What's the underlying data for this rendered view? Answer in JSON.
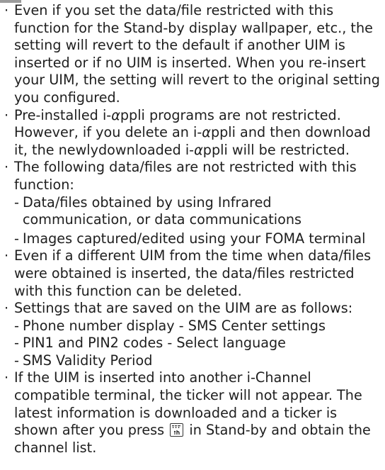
{
  "notes": [
    {
      "text": "Even if you set the data/file restricted with this function for the Stand-by display wallpaper, etc., the setting will revert to the default if another UIM is inserted or if no UIM is inserted. When you re-insert your UIM, the setting will revert to the original setting you configured."
    },
    {
      "part_a": "Pre-installed i-",
      "alpha_a": "α",
      "part_b": "ppli programs are not restricted. However, if you delete an i-",
      "alpha_b": "α",
      "part_c": "ppli and then download it, the newlydownloaded i-",
      "alpha_c": "α",
      "part_d": "ppli will be restricted."
    },
    {
      "text": "The following data/files are not restricted with this function:"
    },
    {
      "text": "Data/files obtained by using Infrared communication, or data communications"
    },
    {
      "text": "Images captured/edited using your FOMA terminal"
    },
    {
      "text": "Even if a different UIM from the time when data/files were obtained is inserted, the data/files restricted with this function can be deleted."
    },
    {
      "text": "Settings that are saved on the UIM are as follows:"
    },
    {
      "text": "Phone number display - SMS Center settings"
    },
    {
      "text": "PIN1 and PIN2 codes - Select language"
    },
    {
      "text": "SMS Validity Period"
    },
    {
      "part_a": "If the UIM is inserted into another i-Channel compatible terminal, the ticker will not appear. The latest information is downloaded and a ticker is shown after you press",
      "part_b": "in Stand-by and obtain the channel list."
    }
  ],
  "dash": "-",
  "icons": {
    "channel_key": "i-channel-key-icon"
  }
}
